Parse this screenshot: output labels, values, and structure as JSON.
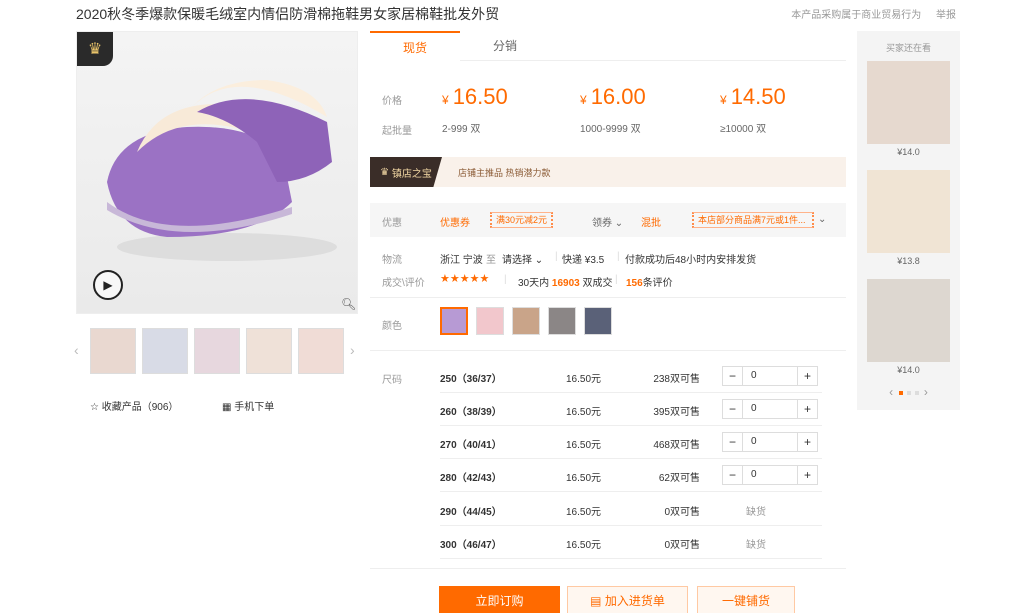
{
  "title": "2020秋冬季爆款保暖毛绒室内情侣防滑棉拖鞋男女家居棉鞋批发外贸",
  "top_right": {
    "notice": "本产品采购属于商业贸易行为",
    "report": "举报"
  },
  "gallery": {
    "favorite": "收藏产品（906）",
    "mobile_order": "手机下单"
  },
  "tabs": [
    "现货",
    "分销"
  ],
  "price": {
    "label": "价格",
    "moq_label": "起批量",
    "currency": "¥",
    "tiers": [
      {
        "price": "16.50",
        "range": "2-999 双"
      },
      {
        "price": "16.00",
        "range": "1000-9999 双"
      },
      {
        "price": "14.50",
        "range": "≥10000 双"
      }
    ]
  },
  "banner": {
    "badge": "镇店之宝",
    "text": "店铺主推品  热销潜力款"
  },
  "coupon": {
    "label": "优惠",
    "coupon_text": "优惠券",
    "coupon_value": "满30元减2元",
    "get_coupon": "领券",
    "mixed_label": "混批",
    "mixed_value": "本店部分商品满7元或1件..."
  },
  "logistics": {
    "label": "物流",
    "origin": "浙江 宁波",
    "to": "至",
    "destination": "请选择",
    "express": "快递 ¥3.5",
    "note": "付款成功后48小时内安排发货"
  },
  "rating": {
    "label": "成交\\评价",
    "period": "30天内",
    "deals": "16903",
    "deals_suffix": "双成交",
    "reviews": "156",
    "reviews_suffix": "条评价",
    "score": 4.5
  },
  "colors_label": "颜色",
  "size_label": "尺码",
  "sizes": [
    {
      "name": "250（36/37）",
      "price": "16.50元",
      "stock": "238双可售",
      "qty": "0",
      "available": true
    },
    {
      "name": "260（38/39）",
      "price": "16.50元",
      "stock": "395双可售",
      "qty": "0",
      "available": true
    },
    {
      "name": "270（40/41）",
      "price": "16.50元",
      "stock": "468双可售",
      "qty": "0",
      "available": true
    },
    {
      "name": "280（42/43）",
      "price": "16.50元",
      "stock": "62双可售",
      "qty": "0",
      "available": true
    },
    {
      "name": "290（44/45）",
      "price": "16.50元",
      "stock": "0双可售",
      "status": "缺货",
      "available": false
    },
    {
      "name": "300（46/47）",
      "price": "16.50元",
      "stock": "0双可售",
      "status": "缺货",
      "available": false
    }
  ],
  "actions": {
    "buy": "立即订购",
    "cart": "加入进货单",
    "dist": "一键铺货"
  },
  "side": {
    "title": "买家还在看",
    "items": [
      {
        "price": "¥14.0"
      },
      {
        "price": "¥13.8"
      },
      {
        "price": "¥14.0"
      }
    ]
  },
  "colors": {
    "accent": "#ff6a00",
    "banner_dark": "#3a2d28"
  }
}
